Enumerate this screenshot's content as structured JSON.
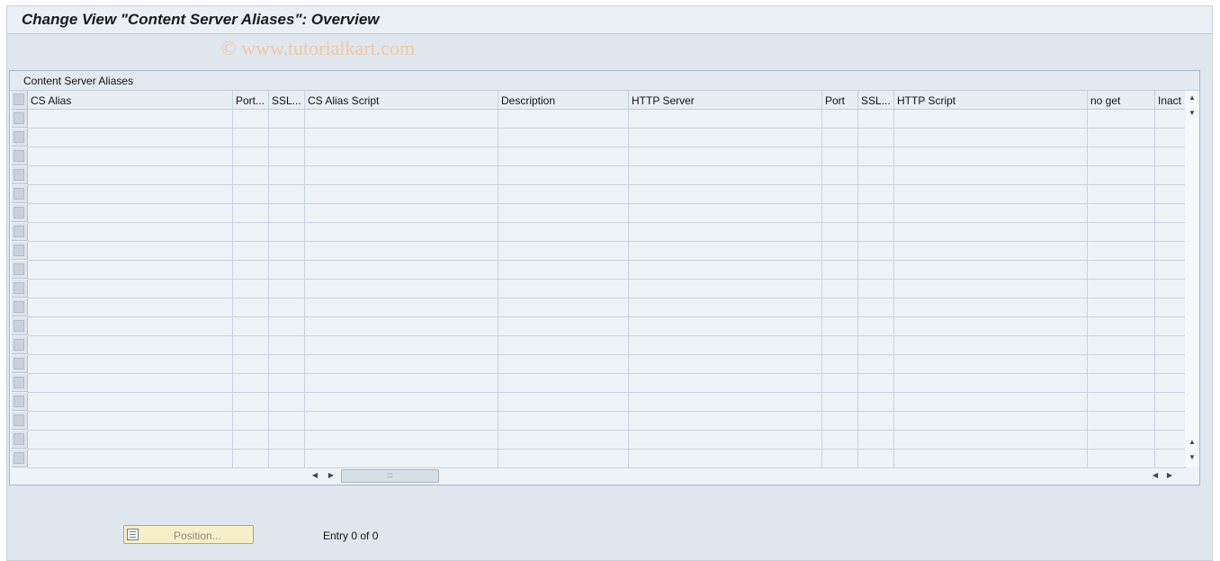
{
  "window": {
    "title": "Change View \"Content Server Aliases\": Overview",
    "watermark": "© www.tutorialkart.com"
  },
  "table": {
    "title": "Content Server Aliases",
    "columns": [
      "CS Alias",
      "Port...",
      "SSL...",
      "CS Alias Script",
      "Description",
      "HTTP Server",
      "Port",
      "SSL...",
      "HTTP Script",
      "no get",
      "Inact"
    ],
    "row_count": 19,
    "column_config_icon": "table-settings-icon"
  },
  "footer": {
    "position_button": "Position...",
    "entry_text": "Entry 0 of 0"
  }
}
